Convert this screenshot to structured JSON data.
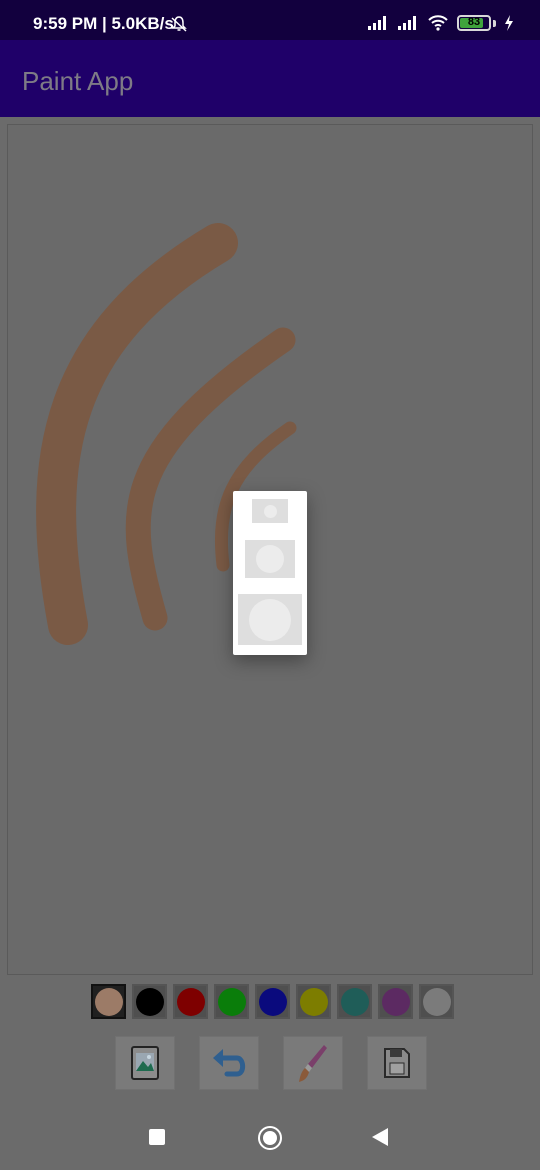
{
  "status": {
    "time": "9:59 PM | 5.0KB/s",
    "battery": "83",
    "battery_level": 0.83
  },
  "app": {
    "title": "Paint App"
  },
  "colors": {
    "status_bar": "#12003e",
    "app_bar": "#1f0069",
    "stroke": "#7a5a45"
  },
  "palette": [
    {
      "name": "skin",
      "color": "#9c7b67",
      "selected": true
    },
    {
      "name": "black",
      "color": "#000000"
    },
    {
      "name": "red",
      "color": "#7e0000"
    },
    {
      "name": "green",
      "color": "#0a7d0a"
    },
    {
      "name": "blue",
      "color": "#0a0a7d"
    },
    {
      "name": "yellow",
      "color": "#7d7d00"
    },
    {
      "name": "teal",
      "color": "#1f5d58"
    },
    {
      "name": "purple",
      "color": "#5c2a62"
    },
    {
      "name": "white",
      "color": "#7b7b7b"
    }
  ],
  "toolbar": [
    {
      "icon": "image-icon"
    },
    {
      "icon": "undo-icon"
    },
    {
      "icon": "brush-icon"
    },
    {
      "icon": "save-icon"
    }
  ],
  "brush_sizes": [
    {
      "size": "small"
    },
    {
      "size": "medium"
    },
    {
      "size": "large"
    }
  ]
}
